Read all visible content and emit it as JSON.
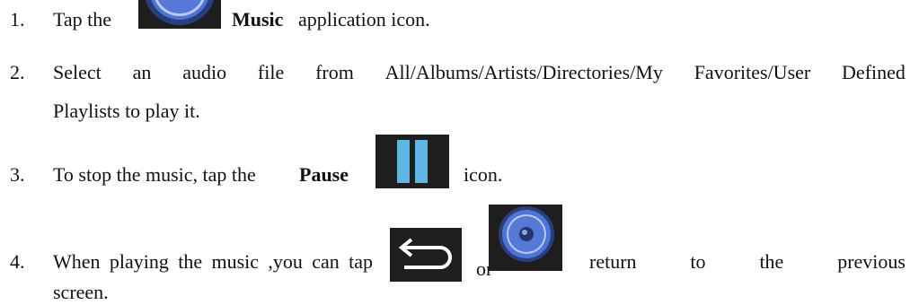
{
  "steps": [
    {
      "number": "1.",
      "text_before": "Tap the",
      "bold": "Music",
      "text_after": "application icon.",
      "icon": "music-speaker-icon"
    },
    {
      "number": "2.",
      "line1_words": [
        "Select",
        "an",
        "audio",
        "file",
        "from",
        "All/Albums/Artists/Directories/My",
        "Favorites/User",
        "Defined"
      ],
      "line2": "Playlists to play it."
    },
    {
      "number": "3.",
      "text_before": "To stop the music, tap the",
      "bold": "Pause",
      "text_after": "icon.",
      "icon": "pause-icon"
    },
    {
      "number": "4.",
      "words_before": [
        "When",
        "playing",
        "the",
        "music",
        ",you",
        "can",
        "tap"
      ],
      "or": "or",
      "words_after": [
        "return",
        "to",
        "the",
        "previous"
      ],
      "line2": "screen.",
      "icons": [
        "back-arrow-icon",
        "music-speaker-icon"
      ]
    }
  ],
  "colors": {
    "icon_bg": "#1e1e1e",
    "speaker_blue": "#4f74d8",
    "pause_bar": "#5fb6e6"
  }
}
